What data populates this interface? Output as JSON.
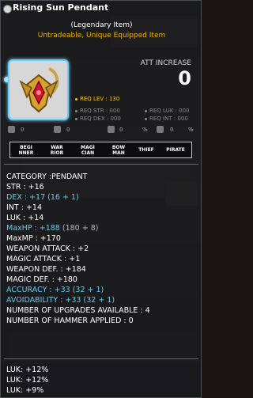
{
  "item": {
    "name": "Rising Sun Pendant",
    "subtitle": "(Legendary Item)",
    "flags": "Untradeable, Unique Equipped Item"
  },
  "att_increase": {
    "label": "ATT INCREASE",
    "value": "0"
  },
  "requirements": {
    "lev": "REQ LEV : 130",
    "str": "REQ STR : 000",
    "luk": "REQ LUK : 000",
    "dex": "REQ DEX : 000",
    "int": "REQ INT : 000"
  },
  "mini_stats": [
    "0",
    "0",
    "0",
    "%",
    "0",
    "%"
  ],
  "jobs": [
    "BEGI NNER",
    "WAR RIOR",
    "MAGI CIAN",
    "BOW MAN",
    "THIEF",
    "PIRATE"
  ],
  "stats": [
    {
      "text": "CATEGORY :PENDANT",
      "extra": "",
      "color": "white"
    },
    {
      "text": "STR : +16",
      "extra": "",
      "color": "white"
    },
    {
      "text": "DEX : +17",
      "extra": "(16 + 1)",
      "color": "cyan"
    },
    {
      "text": "INT : +14",
      "extra": "",
      "color": "white"
    },
    {
      "text": "LUK : +14",
      "extra": "",
      "color": "white"
    },
    {
      "text": "MaxHP : +188",
      "extra": "(180 + 8)",
      "color": "cyan"
    },
    {
      "text": "MaxMP : +170",
      "extra": "",
      "color": "white"
    },
    {
      "text": "WEAPON ATTACK : +2",
      "extra": "",
      "color": "white"
    },
    {
      "text": "MAGIC ATTACK : +1",
      "extra": "",
      "color": "white"
    },
    {
      "text": "WEAPON DEF. : +184",
      "extra": "",
      "color": "white"
    },
    {
      "text": "MAGIC DEF. : +180",
      "extra": "",
      "color": "white"
    },
    {
      "text": "ACCURACY : +33",
      "extra": "(32 + 1)",
      "color": "cyan"
    },
    {
      "text": "AVOIDABILITY : +33",
      "extra": "(32 + 1)",
      "color": "cyan"
    },
    {
      "text": "NUMBER OF UPGRADES AVAILABLE : 4",
      "extra": "",
      "color": "white"
    },
    {
      "text": "NUMBER OF HAMMER APPLIED : 0",
      "extra": "",
      "color": "white"
    }
  ],
  "potentials": [
    "LUK: +12%",
    "LUK: +12%",
    "LUK: +9%"
  ],
  "colors": {
    "accent_cyan": "#66ccee",
    "flag_gold": "#f0b000",
    "frame_glow": "#5fd0ff"
  }
}
